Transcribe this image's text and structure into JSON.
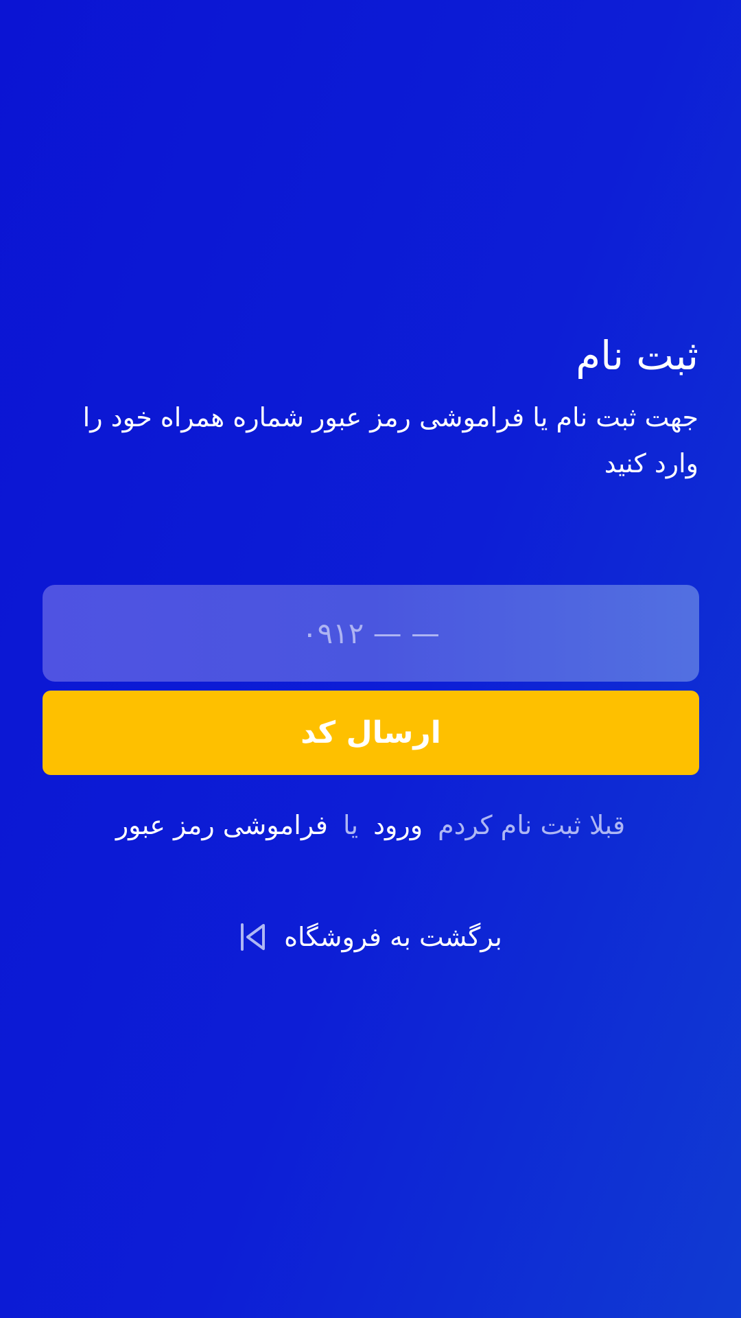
{
  "register": {
    "title": "ثبت نام",
    "description": "جهت ثبت نام یا فراموشی رمز عبور شماره همراه خود را وارد کنید"
  },
  "form": {
    "phone_placeholder": "۰۹۱۲ — —",
    "submit_label": "ارسال کد"
  },
  "links": {
    "already_registered": "قبلا ثبت نام کردم",
    "login": "ورود",
    "or": "یا",
    "forgot_password": "فراموشی رمز عبور",
    "back_to_store": "برگشت به فروشگاه"
  },
  "icons": {
    "back": "skip-back-icon"
  },
  "colors": {
    "background_start": "#0b14d3",
    "background_end": "#103bd2",
    "input_background": "#4f53e2",
    "button": "#fec000",
    "muted_text": "#aeb7f4",
    "text": "#ffffff"
  }
}
